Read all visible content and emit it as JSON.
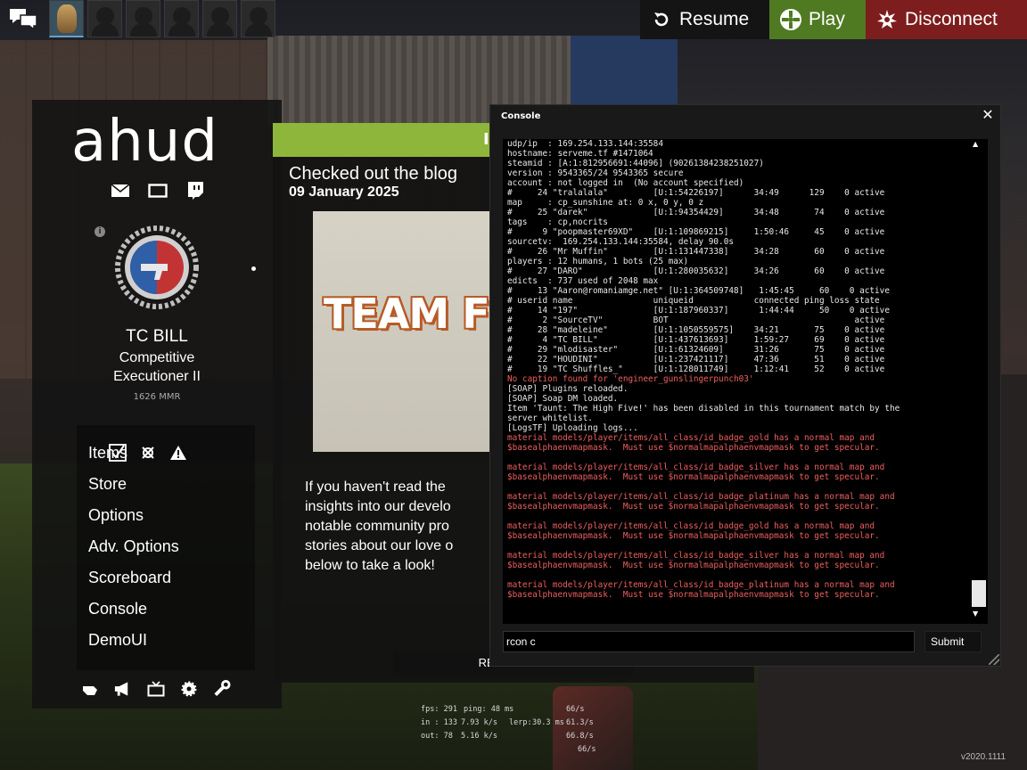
{
  "topbar": {
    "resume_label": "Resume",
    "play_label": "Play",
    "disconnect_label": "Disconnect",
    "colors": {
      "play": "#4f7a22",
      "disconnect": "#7d1d1d",
      "resume": "#141414"
    }
  },
  "sidebar": {
    "logo": "ahud",
    "player": {
      "name": "TC BILL",
      "rank_line1": "Competitive",
      "rank_line2": "Executioner II",
      "mmr": "1626 MMR"
    },
    "menu": {
      "items": "Items",
      "store": "Store",
      "options": "Options",
      "adv_options": "Adv. Options",
      "scoreboard": "Scoreboard",
      "console": "Console",
      "demoui": "DemoUI"
    }
  },
  "news": {
    "header_text": "I",
    "title": "Checked out the blog",
    "date": "09 January 2025",
    "image_text": "TEAM F",
    "body": "If you haven't read the insights into our develo notable community pro stories about our love o below to take a look!",
    "read_more": "READ MORE"
  },
  "console": {
    "title": "Console",
    "input_value": "rcon c",
    "submit_label": "Submit",
    "lines": [
      {
        "t": "udp/ip  : 169.254.133.144:35584",
        "e": false
      },
      {
        "t": "hostname: serveme.tf #1471064",
        "e": false
      },
      {
        "t": "steamid : [A:1:812956691:44096] (90261384238251027)",
        "e": false
      },
      {
        "t": "version : 9543365/24 9543365 secure",
        "e": false
      },
      {
        "t": "account : not logged in  (No account specified)",
        "e": false
      },
      {
        "t": "#     24 \"tralalala\"         [U:1:54226197]      34:49      129    0 active",
        "e": false
      },
      {
        "t": "map     : cp_sunshine at: 0 x, 0 y, 0 z",
        "e": false
      },
      {
        "t": "#     25 \"darek\"             [U:1:94354429]      34:48       74    0 active",
        "e": false
      },
      {
        "t": "tags    : cp,nocrits",
        "e": false
      },
      {
        "t": "#      9 \"poopmaster69XD\"    [U:1:109869215]     1:50:46     45    0 active",
        "e": false
      },
      {
        "t": "sourcetv:  169.254.133.144:35584, delay 90.0s",
        "e": false
      },
      {
        "t": "#     26 \"Mr Muffin\"         [U:1:131447338]     34:28       60    0 active",
        "e": false
      },
      {
        "t": "players : 12 humans, 1 bots (25 max)",
        "e": false
      },
      {
        "t": "#     27 \"DARO\"              [U:1:280035632]     34:26       60    0 active",
        "e": false
      },
      {
        "t": "edicts  : 737 used of 2048 max",
        "e": false
      },
      {
        "t": "#     13 \"Aaron@romaniamge.net\" [U:1:364509748]   1:45:45     60    0 active",
        "e": false
      },
      {
        "t": "# userid name                uniqueid            connected ping loss state",
        "e": false
      },
      {
        "t": "#     14 \"197\"               [U:1:187960337]      1:44:44     50    0 active",
        "e": false
      },
      {
        "t": "#      2 \"SourceTV\"          BOT                                     active",
        "e": false
      },
      {
        "t": "#     28 \"madeleine\"         [U:1:1050559575]    34:21       75    0 active",
        "e": false
      },
      {
        "t": "#      4 \"TC BILL\"           [U:1:437613693]     1:59:27     69    0 active",
        "e": false
      },
      {
        "t": "#     29 \"mlodisaster\"       [U:1:61324609]      31:26       75    0 active",
        "e": false
      },
      {
        "t": "#     22 \"HOUDINI\"           [U:1:237421117]     47:36       51    0 active",
        "e": false
      },
      {
        "t": "#     19 \"TC Shuffles_\"      [U:1:128011749]     1:12:41     52    0 active",
        "e": false
      },
      {
        "t": "No caption found for 'engineer_gunslingerpunch03'",
        "e": true
      },
      {
        "t": "[SOAP] Plugins reloaded.",
        "e": false
      },
      {
        "t": "[SOAP] Soap DM loaded.",
        "e": false
      },
      {
        "t": "Item 'Taunt: The High Five!' has been disabled in this tournament match by the",
        "e": false
      },
      {
        "t": "server whitelist.",
        "e": false
      },
      {
        "t": "[LogsTF] Uploading logs...",
        "e": false
      },
      {
        "t": "material models/player/items/all_class/id_badge_gold has a normal map and",
        "e": true
      },
      {
        "t": "$basealphaenvmapmask.  Must use $normalmapalphaenvmapmask to get specular.",
        "e": true
      },
      {
        "t": "",
        "e": false
      },
      {
        "t": "material models/player/items/all_class/id_badge_silver has a normal map and",
        "e": true
      },
      {
        "t": "$basealphaenvmapmask.  Must use $normalmapalphaenvmapmask to get specular.",
        "e": true
      },
      {
        "t": "",
        "e": false
      },
      {
        "t": "material models/player/items/all_class/id_badge_platinum has a normal map and",
        "e": true
      },
      {
        "t": "$basealphaenvmapmask.  Must use $normalmapalphaenvmapmask to get specular.",
        "e": true
      },
      {
        "t": "",
        "e": false
      },
      {
        "t": "material models/player/items/all_class/id_badge_gold has a normal map and",
        "e": true
      },
      {
        "t": "$basealphaenvmapmask.  Must use $normalmapalphaenvmapmask to get specular.",
        "e": true
      },
      {
        "t": "",
        "e": false
      },
      {
        "t": "material models/player/items/all_class/id_badge_silver has a normal map and",
        "e": true
      },
      {
        "t": "$basealphaenvmapmask.  Must use $normalmapalphaenvmapmask to get specular.",
        "e": true
      },
      {
        "t": "",
        "e": false
      },
      {
        "t": "material models/player/items/all_class/id_badge_platinum has a normal map and",
        "e": true
      },
      {
        "t": "$basealphaenvmapmask.  Must use $normalmapalphaenvmapmask to get specular.",
        "e": true
      }
    ],
    "error_color": "#ef5f5f"
  },
  "netgraph": {
    "fps": "fps: 291",
    "ping": "ping: 48 ms",
    "rate1": "66/s",
    "in": "in : 133",
    "in_rate": "7.93 k/s",
    "lerp": "lerp:",
    "lerp_val": "30.3 ms",
    "rate2": "61.3/s",
    "out": "out: 78",
    "out_rate": "5.16 k/s",
    "rate3": "66.8/s",
    "rate4": "66/s"
  },
  "version": "v2020.1111"
}
